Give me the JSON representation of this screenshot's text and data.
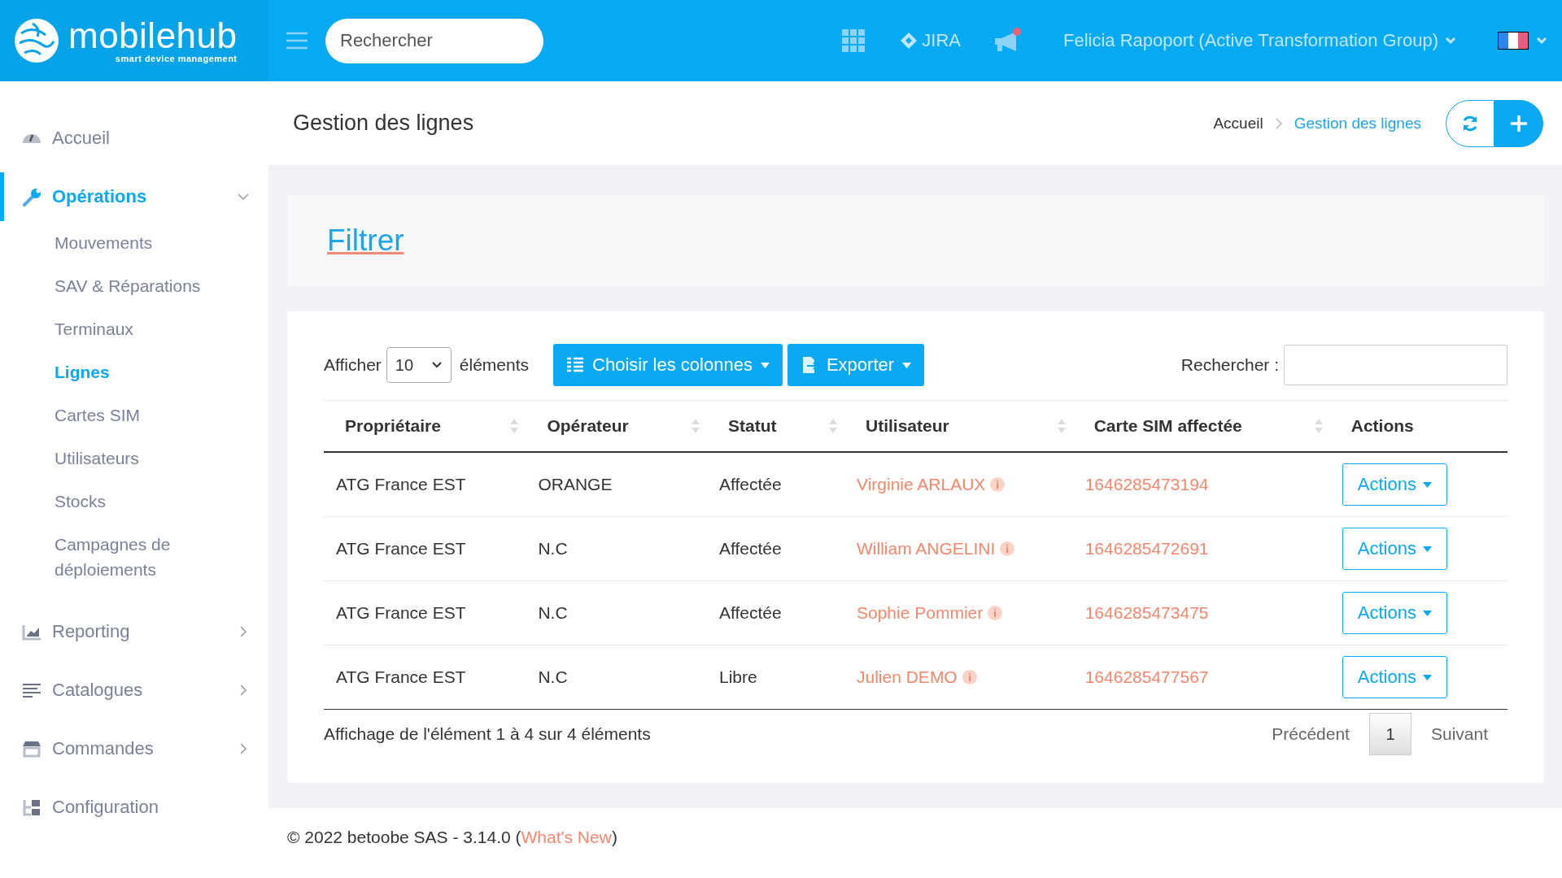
{
  "header": {
    "logo_text": "mobilehub",
    "tagline": "smart device management",
    "search_placeholder": "Rechercher",
    "jira_label": "JIRA",
    "has_notification": true,
    "user_name": "Felicia Rapoport (Active Transformation Group)"
  },
  "sidebar": {
    "items": [
      {
        "label": "Accueil",
        "selected": false
      },
      {
        "label": "Opérations",
        "selected": true,
        "expanded": true,
        "children": [
          {
            "label": "Mouvements",
            "selected": false
          },
          {
            "label": "SAV & Réparations",
            "selected": false
          },
          {
            "label": "Terminaux",
            "selected": false
          },
          {
            "label": "Lignes",
            "selected": true
          },
          {
            "label": "Cartes SIM",
            "selected": false
          },
          {
            "label": "Utilisateurs",
            "selected": false
          },
          {
            "label": "Stocks",
            "selected": false
          },
          {
            "label": "Campagnes de déploiements",
            "selected": false
          }
        ]
      },
      {
        "label": "Reporting",
        "selected": false,
        "expanded": false
      },
      {
        "label": "Catalogues",
        "selected": false,
        "expanded": false
      },
      {
        "label": "Commandes",
        "selected": false,
        "expanded": false
      },
      {
        "label": "Configuration",
        "selected": false
      }
    ]
  },
  "page": {
    "title": "Gestion des lignes",
    "breadcrumb": [
      {
        "label": "Accueil",
        "selected": false
      },
      {
        "label": "Gestion des lignes",
        "selected": true
      }
    ]
  },
  "filter": {
    "title": "Filtrer"
  },
  "table": {
    "show_label": "Afficher",
    "page_size": "10",
    "show_suffix": "éléments",
    "columns_button": "Choisir les colonnes",
    "export_button": "Exporter",
    "search_label": "Rechercher :",
    "columns": [
      {
        "label": "Propriétaire",
        "sortable": true
      },
      {
        "label": "Opérateur",
        "sortable": true
      },
      {
        "label": "Statut",
        "sortable": true
      },
      {
        "label": "Utilisateur",
        "sortable": true
      },
      {
        "label": "Carte SIM affectée",
        "sortable": true
      },
      {
        "label": "Actions",
        "sortable": false
      }
    ],
    "rows": [
      {
        "owner": "ATG France EST",
        "operator": "ORANGE",
        "status": "Affectée",
        "user": "Virginie ARLAUX",
        "sim": "1646285473194",
        "action": "Actions"
      },
      {
        "owner": "ATG France EST",
        "operator": "N.C",
        "status": "Affectée",
        "user": "William ANGELINI",
        "sim": "1646285472691",
        "action": "Actions"
      },
      {
        "owner": "ATG France EST",
        "operator": "N.C",
        "status": "Affectée",
        "user": "Sophie Pommier",
        "sim": "1646285473475",
        "action": "Actions"
      },
      {
        "owner": "ATG France EST",
        "operator": "N.C",
        "status": "Libre",
        "user": "Julien DEMO",
        "sim": "1646285477567",
        "action": "Actions"
      }
    ],
    "info": "Affichage de l'élément 1 à 4 sur 4 éléments",
    "pagination": {
      "previous": "Précédent",
      "pages": [
        {
          "label": "1",
          "selected": true
        }
      ],
      "next": "Suivant"
    }
  },
  "footer": {
    "text_before": "© 2022 betoobe SAS - 3.14.0 (",
    "link": "What's New",
    "text_after": ")"
  }
}
